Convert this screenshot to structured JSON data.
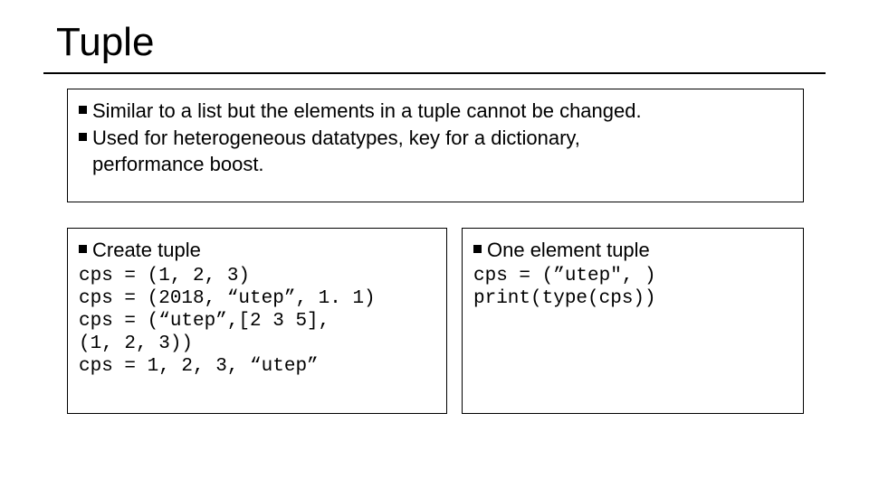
{
  "title": "Tuple",
  "top": {
    "b1": "Similar to a list but the elements in a tuple cannot be changed.",
    "b2a": "Used for heterogeneous datatypes, key for a dictionary,",
    "b2b": "performance boost."
  },
  "left": {
    "heading": "Create tuple",
    "l1": "cps = (1, 2, 3)",
    "l2": "cps = (2018, “utep”, 1. 1)",
    "l3a": "cps = (“utep”,[2 3 5],",
    "l3b": "(1, 2, 3))",
    "l4": "cps = 1, 2, 3, “utep”"
  },
  "right": {
    "heading": "One element tuple",
    "l1": "cps = (”utep\", )",
    "l2": "print(type(cps))"
  }
}
